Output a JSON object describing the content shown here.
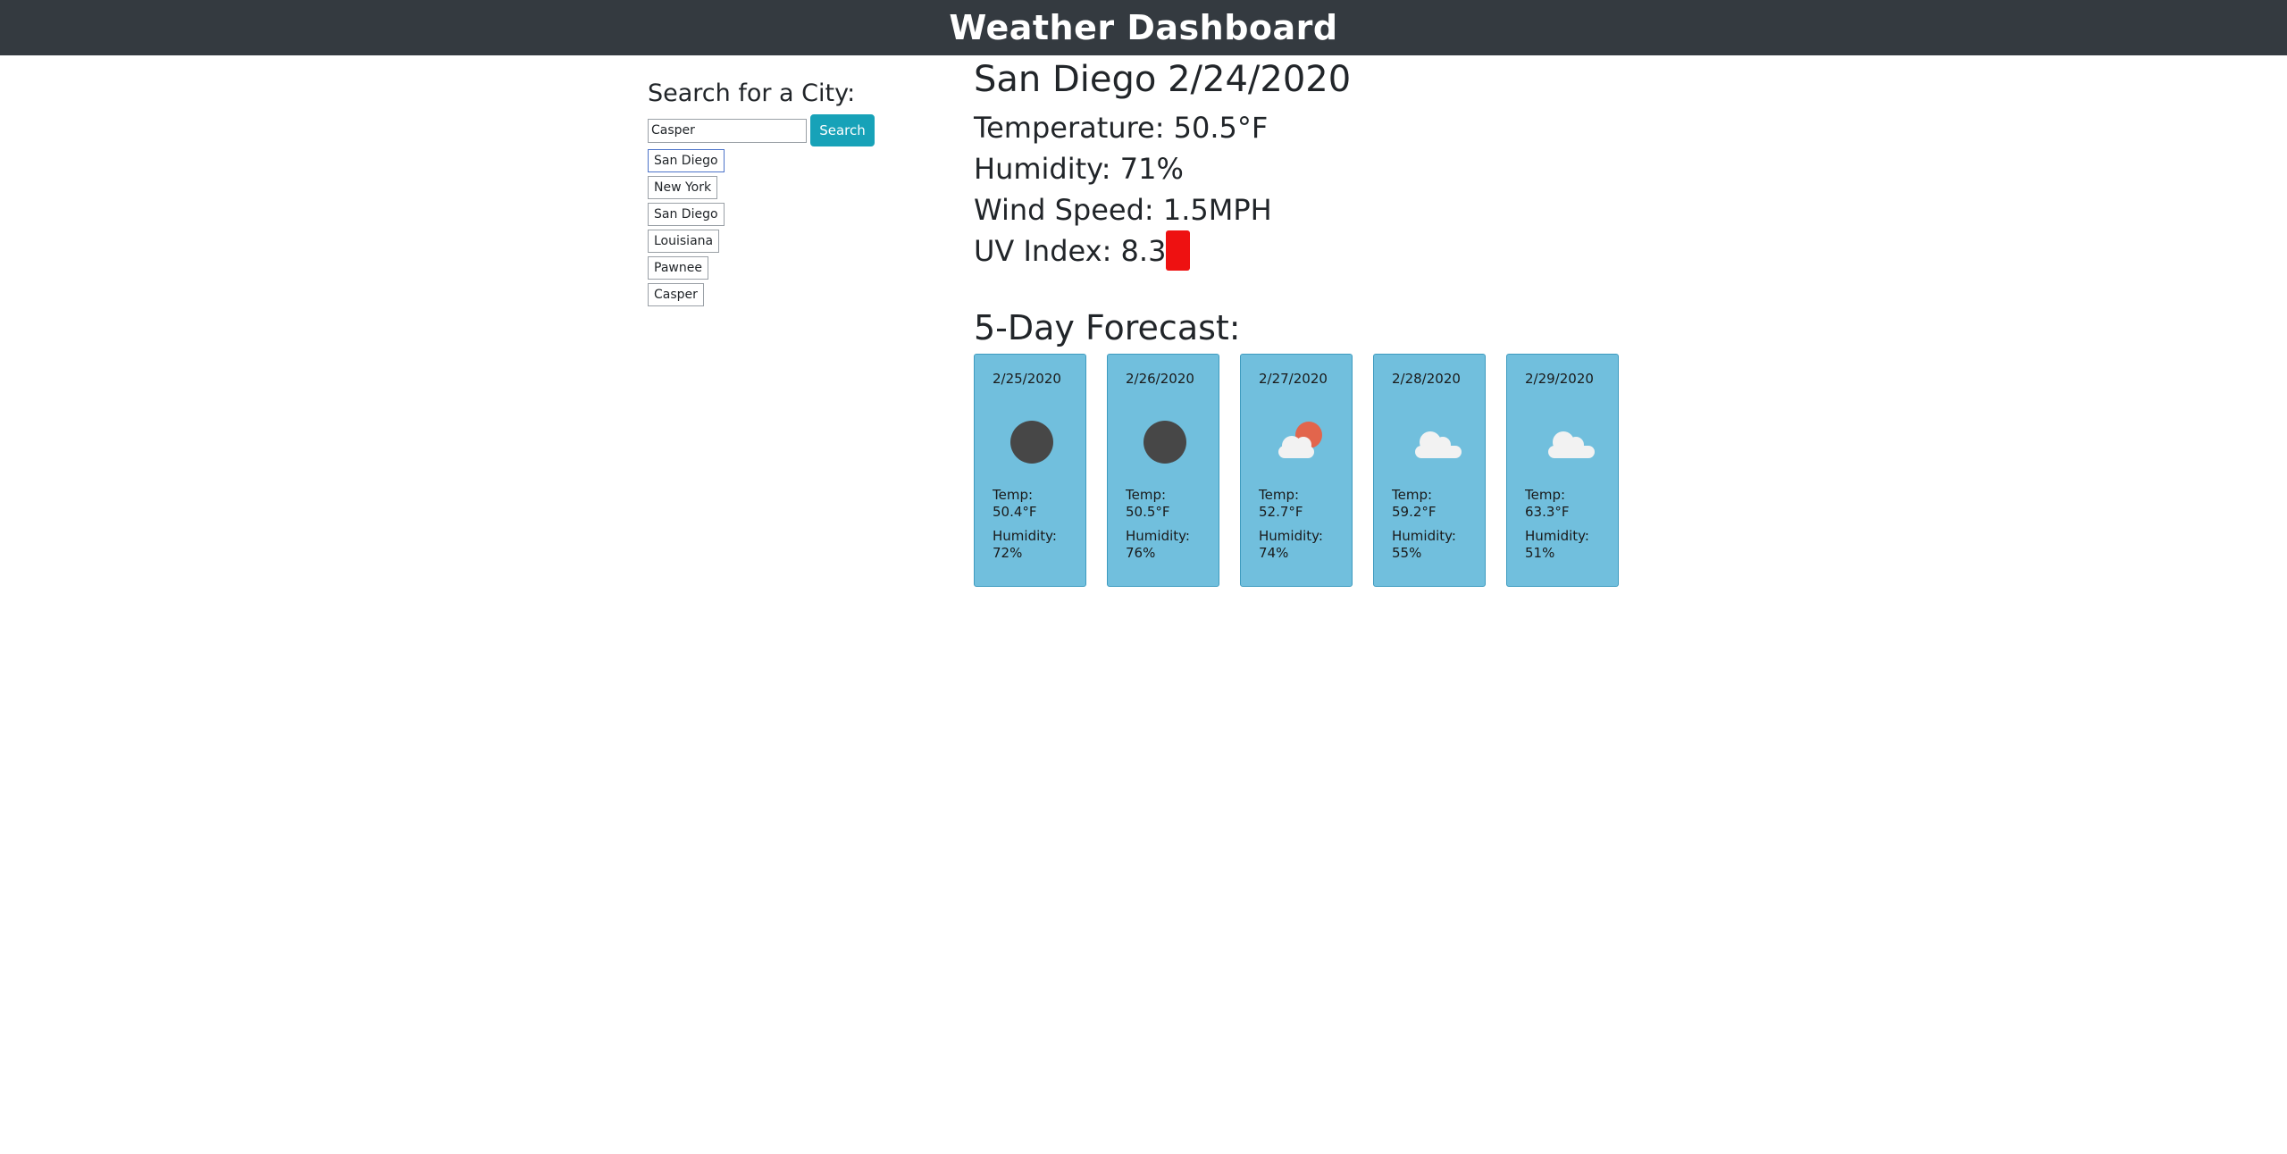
{
  "header": {
    "title": "Weather Dashboard"
  },
  "search": {
    "heading": "Search for a City:",
    "input_value": "Casper",
    "button_label": "Search"
  },
  "history": [
    {
      "label": "San Diego"
    },
    {
      "label": "New York"
    },
    {
      "label": "San Diego"
    },
    {
      "label": "Louisiana"
    },
    {
      "label": "Pawnee"
    },
    {
      "label": "Casper"
    }
  ],
  "current": {
    "title": "San Diego 2/24/2020",
    "temperature": "Temperature: 50.5°F",
    "humidity": "Humidity: 71%",
    "wind": "Wind Speed: 1.5MPH",
    "uv": "UV Index: 8.3",
    "uv_color": "#ee1111"
  },
  "forecast": {
    "heading": "5-Day Forecast:",
    "days": [
      {
        "date": "2/25/2020",
        "icon": "night-clear-icon",
        "temp_label": "Temp:",
        "temp": "50.4°F",
        "hum_label": "Humidity:",
        "humidity": "72%"
      },
      {
        "date": "2/26/2020",
        "icon": "night-clear-icon",
        "temp_label": "Temp:",
        "temp": "50.5°F",
        "hum_label": "Humidity:",
        "humidity": "76%"
      },
      {
        "date": "2/27/2020",
        "icon": "partly-cloudy-icon",
        "temp_label": "Temp:",
        "temp": "52.7°F",
        "hum_label": "Humidity:",
        "humidity": "74%"
      },
      {
        "date": "2/28/2020",
        "icon": "cloud-icon",
        "temp_label": "Temp:",
        "temp": "59.2°F",
        "hum_label": "Humidity:",
        "humidity": "55%"
      },
      {
        "date": "2/29/2020",
        "icon": "cloud-icon",
        "temp_label": "Temp:",
        "temp": "63.3°F",
        "hum_label": "Humidity:",
        "humidity": "51%"
      }
    ]
  },
  "colors": {
    "navbar": "#343a40",
    "search_button": "#17a2b8",
    "card_background": "#71bfdd"
  }
}
